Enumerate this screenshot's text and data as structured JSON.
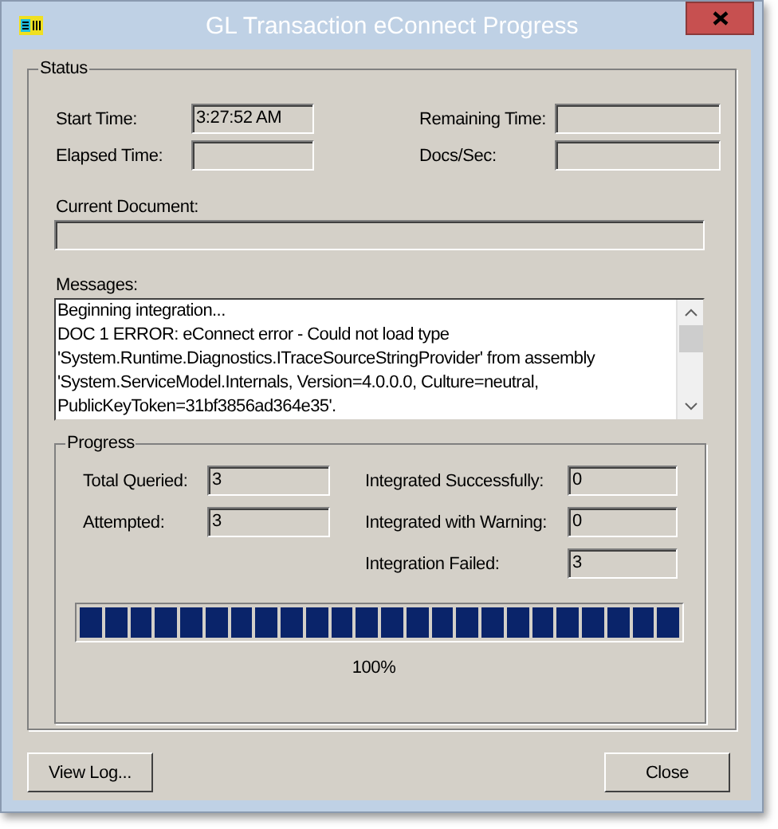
{
  "window": {
    "title": "GL Transaction eConnect Progress"
  },
  "status": {
    "title": "Status",
    "fields": [
      {
        "label": "Start Time:",
        "value": "3:27:52 AM"
      },
      {
        "label": "Remaining Time:"
      },
      {
        "label": "Elapsed Time:"
      },
      {
        "label": "Docs/Sec:"
      }
    ],
    "current_document": {
      "label": "Current Document:"
    },
    "messages": {
      "label": "Messages:",
      "lines": [
        "Beginning integration...",
        "DOC 1 ERROR: eConnect error - Could not load type",
        "'System.Runtime.Diagnostics.ITraceSourceStringProvider' from assembly",
        "'System.ServiceModel.Internals, Version=4.0.0.0, Culture=neutral,",
        "PublicKeyToken=31bf3856ad364e35'."
      ]
    }
  },
  "progress": {
    "title": "Progress",
    "left": [
      {
        "label": "Total Queried:",
        "value": "3"
      },
      {
        "label": "Attempted:",
        "value": "3"
      }
    ],
    "right": [
      {
        "label": "Integrated Successfully:",
        "value": "0"
      },
      {
        "label": "Integrated with Warning:",
        "value": "0"
      },
      {
        "label": "Integration Failed:",
        "value": "3"
      }
    ],
    "bar": {
      "reading": "100%"
    }
  },
  "buttons": [
    "View Log...",
    "Close"
  ]
}
